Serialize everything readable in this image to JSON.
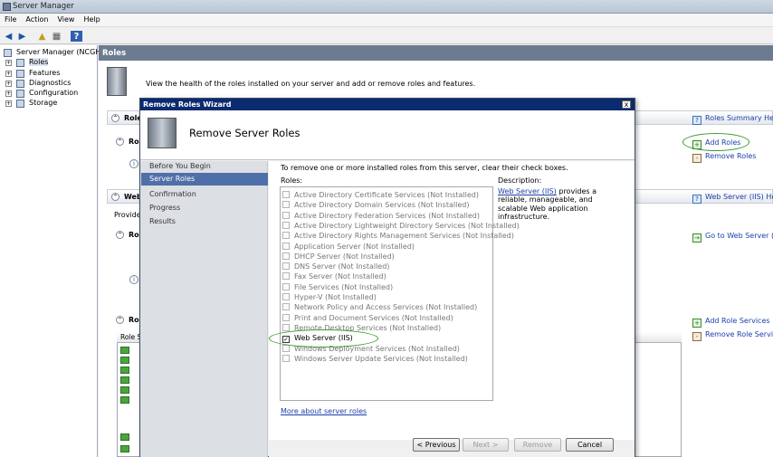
{
  "window": {
    "title": "Server Manager"
  },
  "menu": [
    "File",
    "Action",
    "View",
    "Help"
  ],
  "tree": {
    "root": "Server Manager (NCGHYP",
    "items": [
      "Roles",
      "Features",
      "Diagnostics",
      "Configuration",
      "Storage"
    ]
  },
  "main": {
    "header": "Roles",
    "intro": "View the health of the roles installed on your server and add or remove roles and features.",
    "sections": [
      {
        "title": "Roles"
      },
      {
        "title": "Web"
      }
    ],
    "sub_titles": [
      "Rol",
      "Rol",
      "Rol"
    ],
    "provides": "Provide",
    "list_header": "Role S",
    "links": {
      "roles_summary_help": "Roles Summary Help",
      "add_roles": "Add Roles",
      "remove_roles": "Remove Roles",
      "web_server_help": "Web Server (IIS) Help",
      "go_to_web_server": "Go to Web Server (IIS",
      "add_role_services": "Add Role Services",
      "remove_role_services": "Remove Role Services"
    }
  },
  "dialog": {
    "title": "Remove Roles Wizard",
    "close": "x",
    "heading": "Remove Server Roles",
    "nav": [
      "Before You Begin",
      "Server Roles",
      "Confirmation",
      "Progress",
      "Results"
    ],
    "current_step": "Server Roles",
    "instruction": "To remove one or more installed roles from this server, clear their check boxes.",
    "roles_label": "Roles:",
    "description_label": "Description:",
    "description_link": "Web Server (IIS)",
    "description_text": "provides a reliable, manageable, and scalable Web application infrastructure.",
    "roles": [
      {
        "label": "Active Directory Certificate Services  (Not Installed)",
        "checked": false
      },
      {
        "label": "Active Directory Domain Services  (Not Installed)",
        "checked": false
      },
      {
        "label": "Active Directory Federation Services  (Not Installed)",
        "checked": false
      },
      {
        "label": "Active Directory Lightweight Directory Services  (Not Installed)",
        "checked": false
      },
      {
        "label": "Active Directory Rights Management Services  (Not Installed)",
        "checked": false
      },
      {
        "label": "Application Server  (Not Installed)",
        "checked": false
      },
      {
        "label": "DHCP Server  (Not Installed)",
        "checked": false
      },
      {
        "label": "DNS Server  (Not Installed)",
        "checked": false
      },
      {
        "label": "Fax Server  (Not Installed)",
        "checked": false
      },
      {
        "label": "File Services  (Not Installed)",
        "checked": false
      },
      {
        "label": "Hyper-V  (Not Installed)",
        "checked": false
      },
      {
        "label": "Network Policy and Access Services  (Not Installed)",
        "checked": false
      },
      {
        "label": "Print and Document Services  (Not Installed)",
        "checked": false
      },
      {
        "label": "Remote Desktop Services  (Not Installed)",
        "checked": false
      },
      {
        "label": "Web Server (IIS)",
        "checked": true
      },
      {
        "label": "Windows Deployment Services  (Not Installed)",
        "checked": false
      },
      {
        "label": "Windows Server Update Services  (Not Installed)",
        "checked": false
      }
    ],
    "more_link": "More about server roles",
    "buttons": {
      "previous": "< Previous",
      "next": "Next >",
      "remove": "Remove",
      "cancel": "Cancel"
    }
  },
  "colors": {
    "highlight": "#3a9a2a",
    "dialog_title": "#0b2a6f",
    "nav_selected": "#4f6fa8",
    "header": "#6c7c90"
  }
}
